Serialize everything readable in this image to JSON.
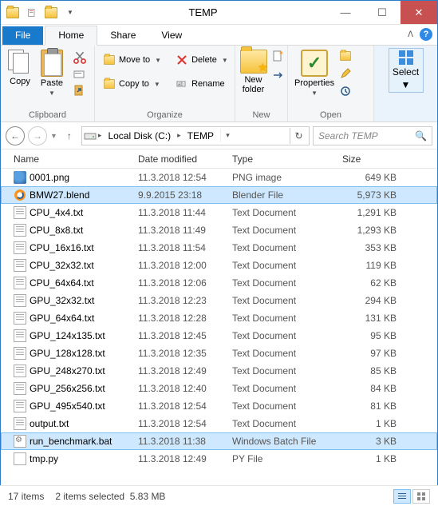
{
  "window": {
    "title": "TEMP"
  },
  "tabs": {
    "file": "File",
    "home": "Home",
    "share": "Share",
    "view": "View"
  },
  "ribbon": {
    "clipboard": {
      "copy": "Copy",
      "paste": "Paste",
      "label": "Clipboard"
    },
    "organize": {
      "moveto": "Move to",
      "copyto": "Copy to",
      "delete": "Delete",
      "rename": "Rename",
      "label": "Organize"
    },
    "new": {
      "newfolder_l1": "New",
      "newfolder_l2": "folder",
      "label": "New"
    },
    "open": {
      "properties": "Properties",
      "label": "Open"
    },
    "select": {
      "select": "Select"
    }
  },
  "breadcrumb": {
    "drive": "Local Disk (C:)",
    "folder": "TEMP"
  },
  "search": {
    "placeholder": "Search TEMP"
  },
  "columns": {
    "name": "Name",
    "date": "Date modified",
    "type": "Type",
    "size": "Size"
  },
  "files": [
    {
      "icon": "png",
      "name": "0001.png",
      "date": "11.3.2018 12:54",
      "type": "PNG image",
      "size": "649 KB",
      "selected": false
    },
    {
      "icon": "blend",
      "name": "BMW27.blend",
      "date": "9.9.2015 23:18",
      "type": "Blender File",
      "size": "5,973 KB",
      "selected": true
    },
    {
      "icon": "txt",
      "name": "CPU_4x4.txt",
      "date": "11.3.2018 11:44",
      "type": "Text Document",
      "size": "1,291 KB",
      "selected": false
    },
    {
      "icon": "txt",
      "name": "CPU_8x8.txt",
      "date": "11.3.2018 11:49",
      "type": "Text Document",
      "size": "1,293 KB",
      "selected": false
    },
    {
      "icon": "txt",
      "name": "CPU_16x16.txt",
      "date": "11.3.2018 11:54",
      "type": "Text Document",
      "size": "353 KB",
      "selected": false
    },
    {
      "icon": "txt",
      "name": "CPU_32x32.txt",
      "date": "11.3.2018 12:00",
      "type": "Text Document",
      "size": "119 KB",
      "selected": false
    },
    {
      "icon": "txt",
      "name": "CPU_64x64.txt",
      "date": "11.3.2018 12:06",
      "type": "Text Document",
      "size": "62 KB",
      "selected": false
    },
    {
      "icon": "txt",
      "name": "GPU_32x32.txt",
      "date": "11.3.2018 12:23",
      "type": "Text Document",
      "size": "294 KB",
      "selected": false
    },
    {
      "icon": "txt",
      "name": "GPU_64x64.txt",
      "date": "11.3.2018 12:28",
      "type": "Text Document",
      "size": "131 KB",
      "selected": false
    },
    {
      "icon": "txt",
      "name": "GPU_124x135.txt",
      "date": "11.3.2018 12:45",
      "type": "Text Document",
      "size": "95 KB",
      "selected": false
    },
    {
      "icon": "txt",
      "name": "GPU_128x128.txt",
      "date": "11.3.2018 12:35",
      "type": "Text Document",
      "size": "97 KB",
      "selected": false
    },
    {
      "icon": "txt",
      "name": "GPU_248x270.txt",
      "date": "11.3.2018 12:49",
      "type": "Text Document",
      "size": "85 KB",
      "selected": false
    },
    {
      "icon": "txt",
      "name": "GPU_256x256.txt",
      "date": "11.3.2018 12:40",
      "type": "Text Document",
      "size": "84 KB",
      "selected": false
    },
    {
      "icon": "txt",
      "name": "GPU_495x540.txt",
      "date": "11.3.2018 12:54",
      "type": "Text Document",
      "size": "81 KB",
      "selected": false
    },
    {
      "icon": "txt",
      "name": "output.txt",
      "date": "11.3.2018 12:54",
      "type": "Text Document",
      "size": "1 KB",
      "selected": false
    },
    {
      "icon": "bat",
      "name": "run_benchmark.bat",
      "date": "11.3.2018 11:38",
      "type": "Windows Batch File",
      "size": "3 KB",
      "selected": true
    },
    {
      "icon": "py",
      "name": "tmp.py",
      "date": "11.3.2018 12:49",
      "type": "PY File",
      "size": "1 KB",
      "selected": false
    }
  ],
  "status": {
    "count": "17 items",
    "selection": "2 items selected",
    "selsize": "5.83 MB"
  }
}
